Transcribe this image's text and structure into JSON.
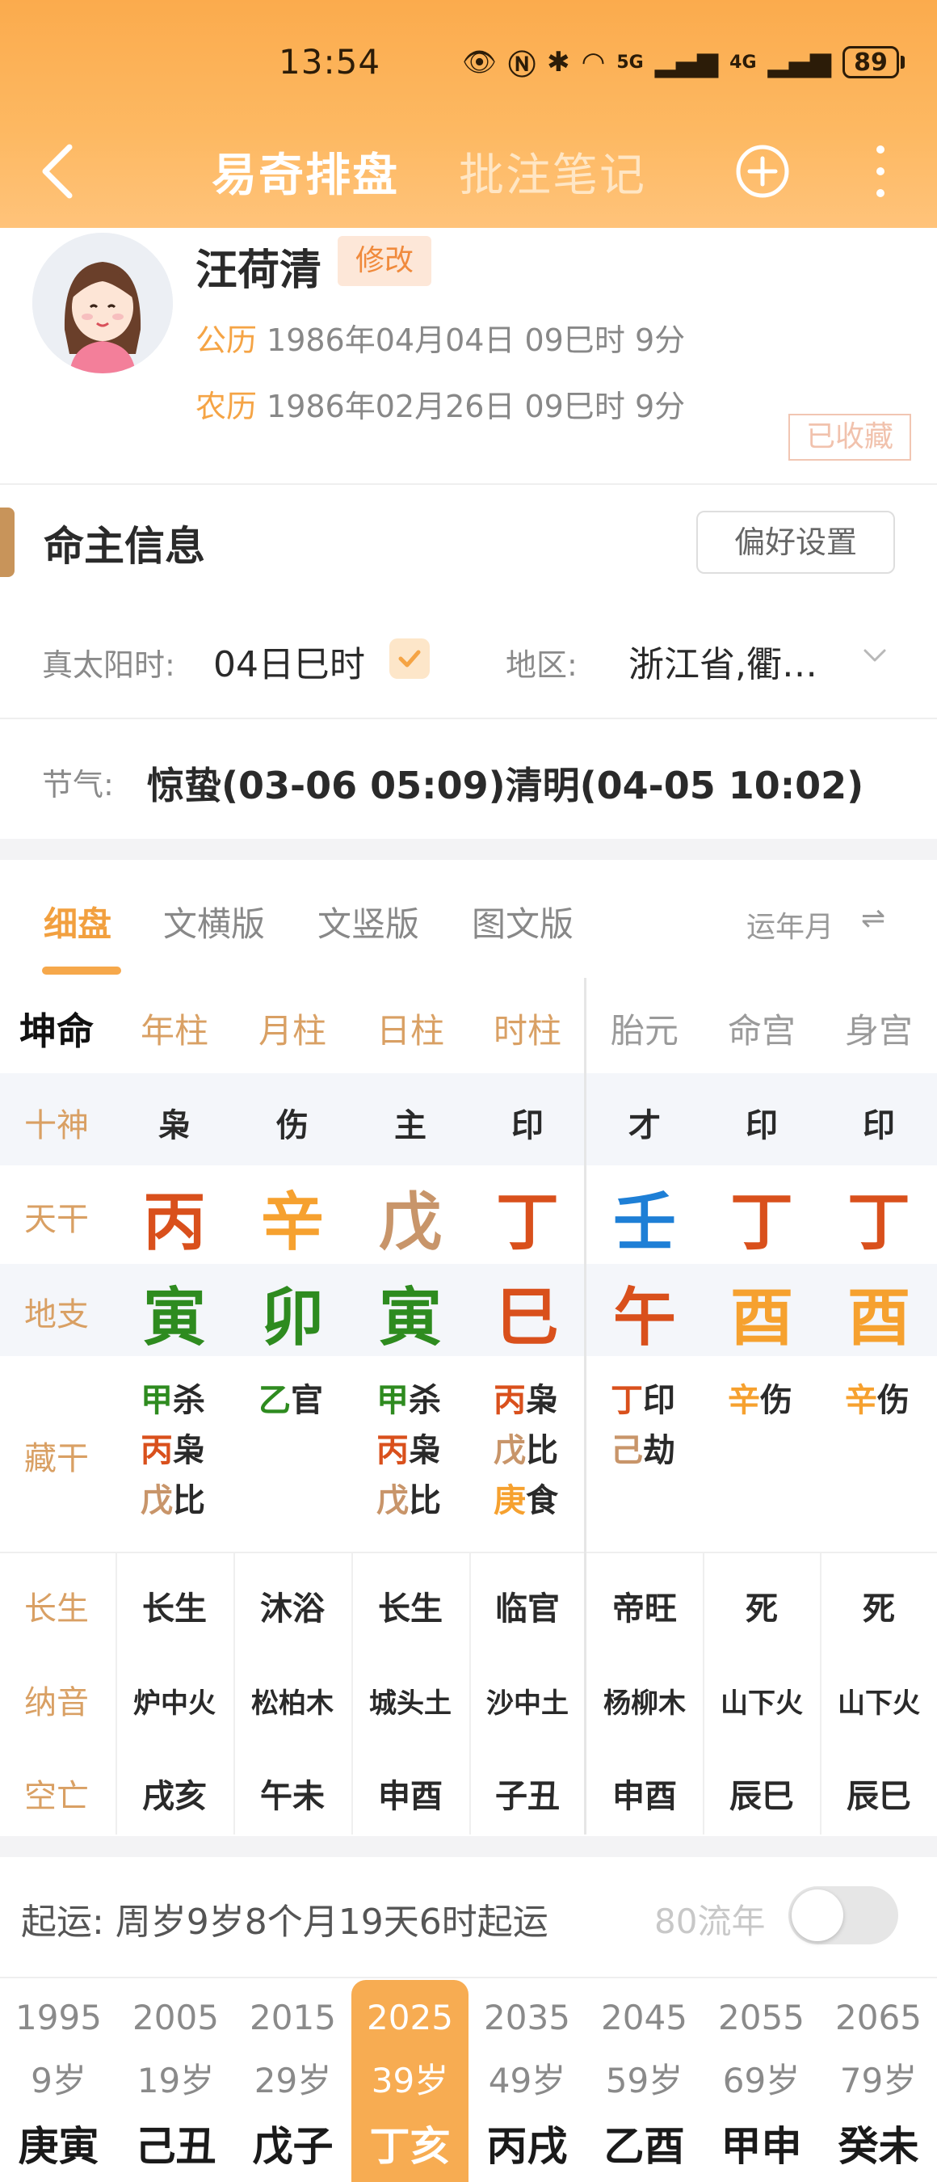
{
  "status_bar": {
    "time": "13:54",
    "net5g": "5G",
    "net4g": "4G",
    "battery": "89"
  },
  "nav": {
    "tab_active": "易奇排盘",
    "tab_inactive": "批注笔记"
  },
  "profile": {
    "name": "汪荷清",
    "edit_label": "修改",
    "solar_label": "公历",
    "solar_value": "1986年04月04日 09巳时 9分",
    "lunar_label": "农历",
    "lunar_value": "1986年02月26日 09巳时 9分",
    "stamp": "已收藏"
  },
  "owner_info": {
    "title": "命主信息",
    "pref_button": "偏好设置",
    "true_solar_label": "真太阳时:",
    "true_solar_value": "04日巳时",
    "region_label": "地区:",
    "region_value": "浙江省,衢…",
    "jieqi_label": "节气:",
    "jieqi_value": "惊蛰(03-06 05:09)清明(04-05 10:02)"
  },
  "view_tabs": [
    "细盘",
    "文横版",
    "文竖版",
    "图文版"
  ],
  "yun_link": "运年月",
  "chart": {
    "corner": "坤命",
    "headers": [
      "年柱",
      "月柱",
      "日柱",
      "时柱",
      "胎元",
      "命宫",
      "身宫"
    ],
    "row_labels": {
      "shishen": "十神",
      "tiangan": "天干",
      "dizhi": "地支",
      "canggan": "藏干",
      "changsheng": "长生",
      "nayin": "纳音",
      "kongwang": "空亡"
    },
    "shishen": [
      "枭",
      "伤",
      "主",
      "印",
      "才",
      "印",
      "印"
    ],
    "tiangan": [
      "丙",
      "辛",
      "戊",
      "丁",
      "壬",
      "丁",
      "丁"
    ],
    "tiangan_colors": [
      "#d9501c",
      "#f6a12f",
      "#c8956a",
      "#d9501c",
      "#1e7fd6",
      "#d9501c",
      "#d9501c"
    ],
    "dizhi": [
      "寅",
      "卯",
      "寅",
      "巳",
      "午",
      "酉",
      "酉"
    ],
    "dizhi_colors": [
      "#2e8b1f",
      "#2e8b1f",
      "#2e8b1f",
      "#d9501c",
      "#d9501c",
      "#f6a12f",
      "#f6a12f"
    ],
    "canggan": [
      [
        {
          "g": "甲",
          "r": "杀",
          "c": "#2e8b1f"
        },
        {
          "g": "丙",
          "r": "枭",
          "c": "#d9501c"
        },
        {
          "g": "戊",
          "r": "比",
          "c": "#c8956a"
        }
      ],
      [
        {
          "g": "乙",
          "r": "官",
          "c": "#2e8b1f"
        }
      ],
      [
        {
          "g": "甲",
          "r": "杀",
          "c": "#2e8b1f"
        },
        {
          "g": "丙",
          "r": "枭",
          "c": "#d9501c"
        },
        {
          "g": "戊",
          "r": "比",
          "c": "#c8956a"
        }
      ],
      [
        {
          "g": "丙",
          "r": "枭",
          "c": "#d9501c"
        },
        {
          "g": "戊",
          "r": "比",
          "c": "#c8956a"
        },
        {
          "g": "庚",
          "r": "食",
          "c": "#f6a12f"
        }
      ],
      [
        {
          "g": "丁",
          "r": "印",
          "c": "#d9501c"
        },
        {
          "g": "己",
          "r": "劫",
          "c": "#c8956a"
        }
      ],
      [
        {
          "g": "辛",
          "r": "伤",
          "c": "#f6a12f"
        }
      ],
      [
        {
          "g": "辛",
          "r": "伤",
          "c": "#f6a12f"
        }
      ]
    ],
    "changsheng": [
      "长生",
      "沐浴",
      "长生",
      "临官",
      "帝旺",
      "死",
      "死"
    ],
    "nayin": [
      "炉中火",
      "松柏木",
      "城头土",
      "沙中土",
      "杨柳木",
      "山下火",
      "山下火"
    ],
    "kongwang": [
      "戌亥",
      "午未",
      "申酉",
      "子丑",
      "申酉",
      "辰巳",
      "辰巳"
    ]
  },
  "qiyun": {
    "text": "起运:  周岁9岁8个月19天6时起运",
    "liunian_label": "80流年",
    "liunian_on": false
  },
  "dayun": {
    "active_index": 3,
    "items": [
      {
        "year": "1995",
        "age": "9岁",
        "gz": "庚寅"
      },
      {
        "year": "2005",
        "age": "19岁",
        "gz": "己丑"
      },
      {
        "year": "2015",
        "age": "29岁",
        "gz": "戊子"
      },
      {
        "year": "2025",
        "age": "39岁",
        "gz": "丁亥"
      },
      {
        "year": "2035",
        "age": "49岁",
        "gz": "丙戌"
      },
      {
        "year": "2045",
        "age": "59岁",
        "gz": "乙酉"
      },
      {
        "year": "2055",
        "age": "69岁",
        "gz": "甲申"
      },
      {
        "year": "2065",
        "age": "79岁",
        "gz": "癸未"
      }
    ]
  },
  "colors": {
    "accent": "#f6a84b",
    "header_gold": "#d9a064"
  }
}
